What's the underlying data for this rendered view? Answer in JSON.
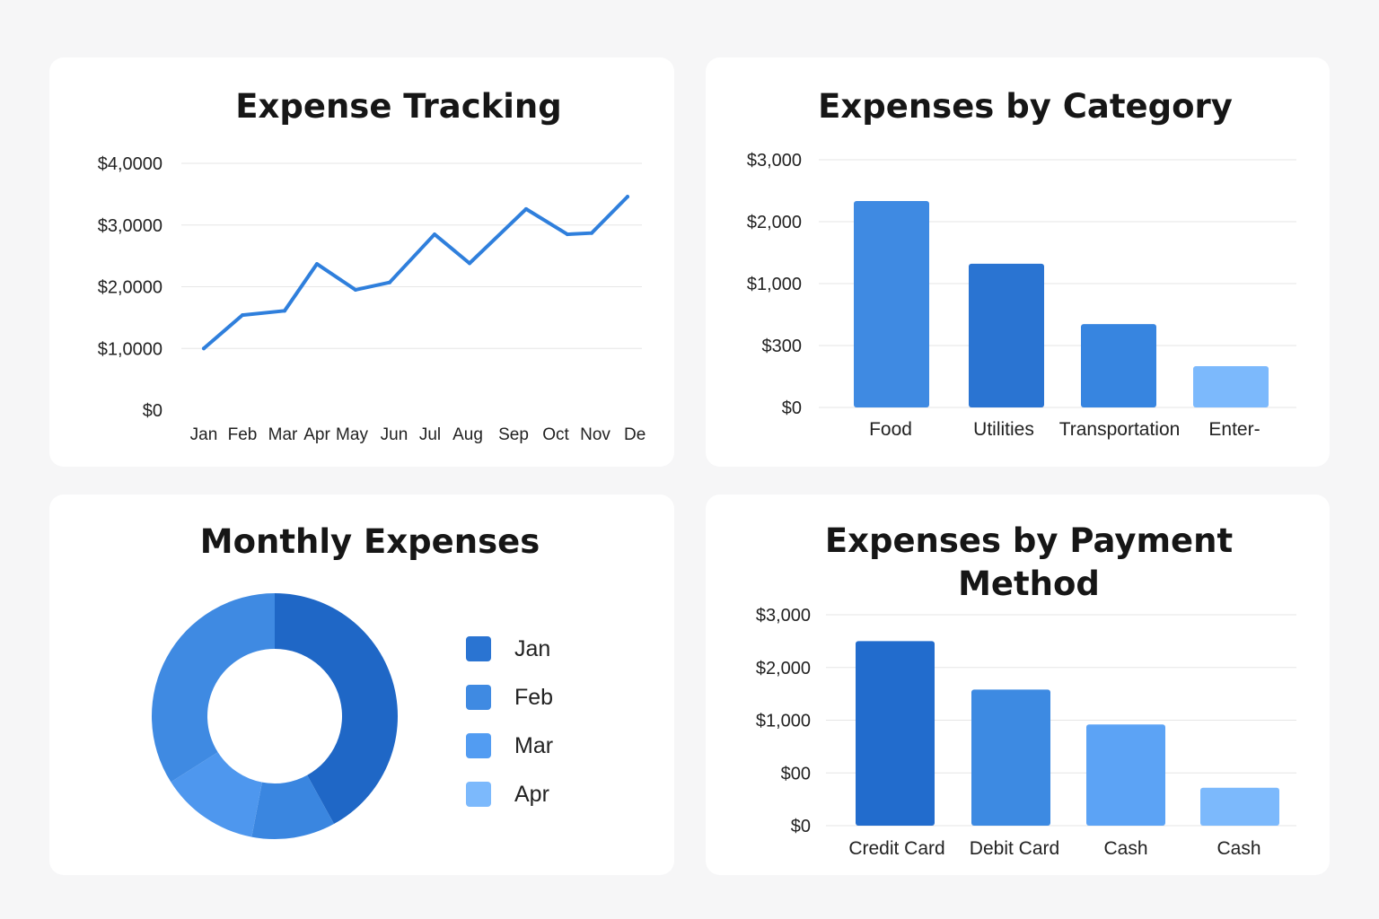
{
  "colors": {
    "line": "#2f7fdc",
    "grid": "#e6e6e6",
    "text": "#161616",
    "category_bars": [
      "#3f8ae2",
      "#2a74d2",
      "#3785e0",
      "#7cb9fc"
    ],
    "payment_bars": [
      "#226ccd",
      "#3d8ae2",
      "#5ca3f5",
      "#7cb9fc"
    ],
    "donut": [
      "#1f67c6",
      "#3a86e0",
      "#4e97ee",
      "#3f8ae2"
    ],
    "legend": [
      "#2a74d2",
      "#3f8ae2",
      "#529cf2",
      "#7cb9fc"
    ]
  },
  "chart_data": [
    {
      "type": "line",
      "title": "Expense Tracking",
      "x": [
        "Jan",
        "Feb",
        "Mar",
        "Apr",
        "May",
        "Jun",
        "Jul",
        "Aug",
        "Sep",
        "Oct",
        "Nov",
        "De"
      ],
      "y_ticks": [
        "$4,0000",
        "$3,0000",
        "$2,0000",
        "$1,0000",
        "$0"
      ],
      "series": [
        {
          "values": [
            1000,
            1540,
            1610,
            2370,
            1950,
            2070,
            2850,
            2380,
            3260,
            2850,
            2870,
            3460
          ]
        }
      ],
      "ylim": [
        0,
        4000
      ],
      "grid": true
    },
    {
      "type": "bar",
      "title": "Expenses by Category",
      "categories": [
        "Food",
        "Utilities",
        "Transportation",
        "Enter-"
      ],
      "values": [
        2500,
        1740,
        1010,
        500
      ],
      "y_ticks": [
        "$3,000",
        "$2,000",
        "$1,000",
        "$300",
        "$0"
      ],
      "ylim": [
        0,
        3000
      ],
      "grid": true
    },
    {
      "type": "pie",
      "title": "Monthly Expenses",
      "labels": [
        "Jan",
        "Feb",
        "Mar",
        "Apr"
      ],
      "values": [
        42,
        11,
        13,
        34
      ],
      "donut": true,
      "legend": "right"
    },
    {
      "type": "bar",
      "title_lines": [
        "Expenses by Payment",
        "Method"
      ],
      "categories": [
        "Credit Card",
        "Debit Card",
        "Cash",
        "Cash"
      ],
      "values": [
        3500,
        2580,
        1920,
        720
      ],
      "y_ticks": [
        "$3,000",
        "$2,000",
        "$1,000",
        "$00",
        "$0"
      ],
      "ylim": [
        0,
        4000
      ],
      "grid": true
    }
  ]
}
